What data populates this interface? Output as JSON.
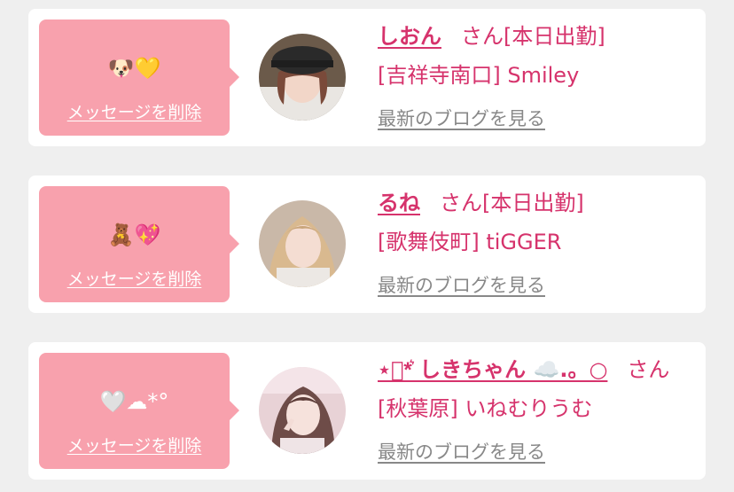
{
  "messages": [
    {
      "stamp": "🐶💛",
      "delete_label": "メッセージを削除",
      "name": "しおん",
      "status": "さん[本日出勤]",
      "shop": "[吉祥寺南口] Smiley",
      "blog_label": "最新のブログを見る"
    },
    {
      "stamp": "🧸💖",
      "delete_label": "メッセージを削除",
      "name": "るね",
      "status": "さん[本日出勤]",
      "shop": "[歌舞伎町] tiGGER",
      "blog_label": "最新のブログを見る"
    },
    {
      "stamp": "🤍☁*°",
      "delete_label": "メッセージを削除",
      "name": "⋆͛*͛ しきちゃん ☁️.。○",
      "status": "さん",
      "shop": "[秋葉原] いねむりうむ",
      "blog_label": "最新のブログを見る"
    }
  ],
  "colors": {
    "bubble": "#f8a1ad",
    "accent": "#d6336c",
    "muted": "#888888",
    "background": "#efefef"
  }
}
